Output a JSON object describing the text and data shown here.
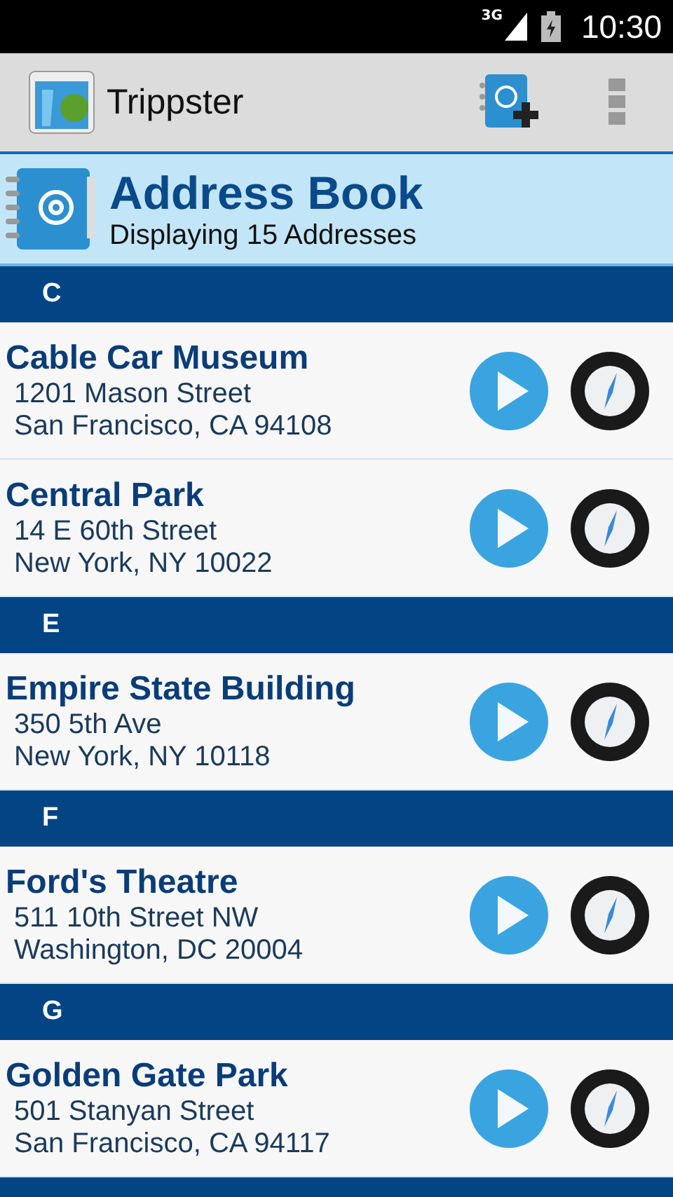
{
  "status_bar": {
    "network": "3G",
    "time": "10:30"
  },
  "action_bar": {
    "title": "Trippster"
  },
  "header": {
    "title": "Address Book",
    "subtitle": "Displaying 15 Addresses"
  },
  "sections": [
    {
      "letter": "C",
      "addresses": [
        {
          "name": "Cable Car Museum",
          "street": "1201 Mason Street",
          "city": "San Francisco, CA 94108"
        },
        {
          "name": "Central Park",
          "street": "14 E 60th Street",
          "city": "New York, NY 10022"
        }
      ]
    },
    {
      "letter": "E",
      "addresses": [
        {
          "name": "Empire State Building",
          "street": "350 5th Ave",
          "city": "New York, NY 10118"
        }
      ]
    },
    {
      "letter": "F",
      "addresses": [
        {
          "name": "Ford's Theatre",
          "street": "511 10th Street NW",
          "city": "Washington, DC 20004"
        }
      ]
    },
    {
      "letter": "G",
      "addresses": [
        {
          "name": "Golden Gate Park",
          "street": "501 Stanyan Street",
          "city": "San Francisco, CA 94117"
        }
      ]
    }
  ]
}
